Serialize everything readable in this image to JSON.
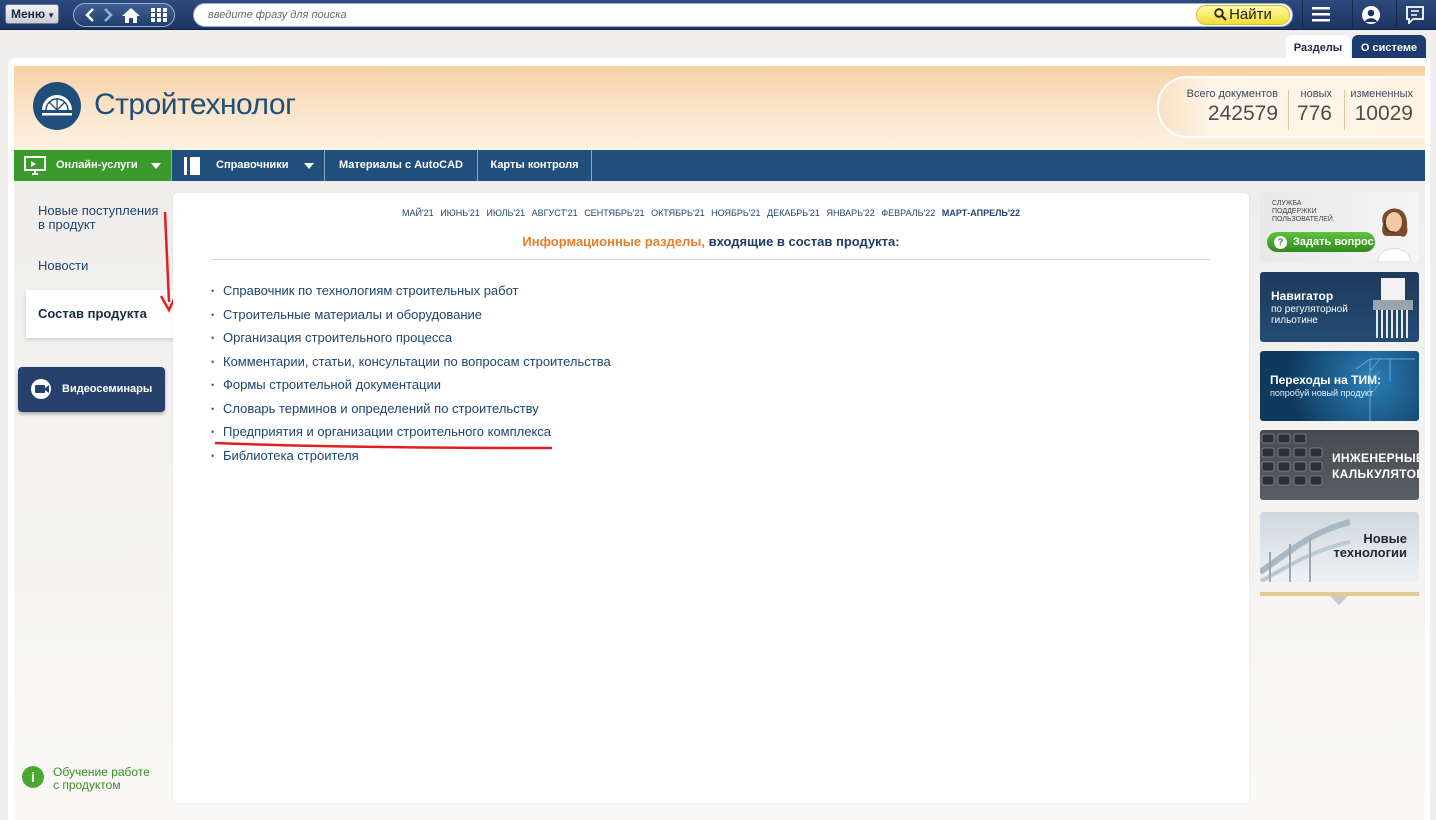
{
  "topbar": {
    "menu_label": "Меню",
    "search_placeholder": "введите фразу для поиска",
    "find_label": "Найти"
  },
  "tabs": {
    "sections": "Разделы",
    "about": "О системе"
  },
  "header": {
    "brand": "Стройтехнолог",
    "stats": [
      {
        "label": "Всего документов",
        "value": "242579"
      },
      {
        "label": "новых",
        "value": "776"
      },
      {
        "label": "измененных",
        "value": "10029"
      }
    ]
  },
  "nav": {
    "online": "Онлайн-услуги",
    "references": "Справочники",
    "autocad": "Материалы с AutoCAD",
    "control_cards": "Карты контроля"
  },
  "sidebar": {
    "new_line1": "Новые поступления",
    "new_line2": "в продукт",
    "news": "Новости",
    "composition": "Состав продукта",
    "video": "Видеосеминары",
    "learn_line1": "Обучение работе",
    "learn_line2": "с продуктом"
  },
  "content": {
    "months": [
      "МАЙ'21",
      "ИЮНЬ'21",
      "ИЮЛЬ'21",
      "АВГУСТ'21",
      "СЕНТЯБРЬ'21",
      "ОКТЯБРЬ'21",
      "НОЯБРЬ'21",
      "ДЕКАБРЬ'21",
      "ЯНВАРЬ'22",
      "ФЕВРАЛЬ'22",
      "МАРТ-АПРЕЛЬ'22"
    ],
    "title_orange": "Информационные разделы,",
    "title_blue": "входящие в состав продукта:",
    "items": [
      "Справочник по технологиям строительных работ",
      "Строительные материалы и оборудование",
      "Организация строительного процесса",
      "Комментарии, статьи, консультации по вопросам строительства",
      "Формы строительной документации",
      "Словарь терминов и определений по строительству",
      "Предприятия и организации строительного комплекса",
      "Библиотека строителя"
    ]
  },
  "banners": {
    "support_line1": "СЛУЖБА",
    "support_line2": "ПОДДЕРЖКИ",
    "support_line3": "ПОЛЬЗОВАТЕЛЕЙ",
    "ask": "Задать вопрос",
    "nav_title": "Навигатор",
    "nav_sub1": "по регуляторной",
    "nav_sub2": "гильотине",
    "tim_title": "Переходы на ТИМ:",
    "tim_sub": "попробуй новый продукт",
    "calc_line1": "ИНЖЕНЕРНЫЕ",
    "calc_line2": "КАЛЬКУЛЯТОРЫ",
    "tech_line1": "Новые",
    "tech_line2": "технологии"
  },
  "colors": {
    "nav_bg": "#1f4f7a",
    "online_green": "#3a9a2b",
    "title_orange": "#e87e2a",
    "link_blue": "#1d4570",
    "annotation_red": "#e02020"
  }
}
